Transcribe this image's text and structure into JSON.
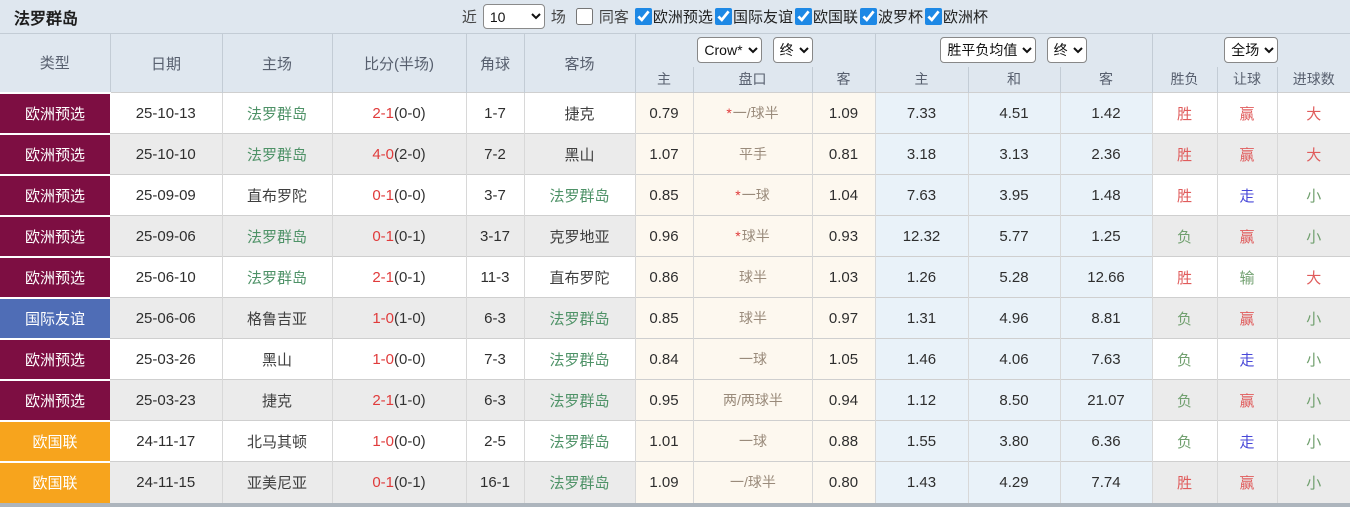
{
  "page": {
    "title": "法罗群岛"
  },
  "toolbar": {
    "recent_label": "近",
    "recent_select": "10",
    "matches_label": "场",
    "same_away_label": "同客",
    "same_away_checked": false,
    "filters": [
      {
        "label": "欧洲预选",
        "checked": true
      },
      {
        "label": "国际友谊",
        "checked": true
      },
      {
        "label": "欧国联",
        "checked": true
      },
      {
        "label": "波罗杯",
        "checked": true
      },
      {
        "label": "欧洲杯",
        "checked": true
      }
    ]
  },
  "table": {
    "static_headers": [
      "类型",
      "日期",
      "主场",
      "比分(半场)",
      "角球",
      "客场"
    ],
    "handicap_group": {
      "provider_select": "Crow*",
      "period_select": "终",
      "subheaders": [
        "主",
        "盘口",
        "客"
      ]
    },
    "europe_group": {
      "avg_select": "胜平负均值",
      "period_select": "终",
      "subheaders": [
        "主",
        "和",
        "客"
      ]
    },
    "result_group": {
      "scope_select": "全场",
      "subheaders": [
        "胜负",
        "让球",
        "进球数"
      ]
    },
    "rows": [
      {
        "type": "欧洲预选",
        "type_class": "maroon",
        "date": "25-10-13",
        "home": "法罗群岛",
        "home_subject": true,
        "score": "2-1",
        "half": "(0-0)",
        "corners": "1-7",
        "away": "捷克",
        "away_subject": false,
        "crow_home": "0.79",
        "handicap_star": true,
        "handicap": "一/球半",
        "crow_away": "1.09",
        "euro_home": "7.33",
        "euro_draw": "4.51",
        "euro_away": "1.42",
        "result": "胜",
        "result_class": "red",
        "handicap_result": "赢",
        "handicap_result_class": "red",
        "goals": "大",
        "goals_class": "red"
      },
      {
        "type": "欧洲预选",
        "type_class": "maroon",
        "date": "25-10-10",
        "home": "法罗群岛",
        "home_subject": true,
        "score": "4-0",
        "half": "(2-0)",
        "corners": "7-2",
        "away": "黑山",
        "away_subject": false,
        "crow_home": "1.07",
        "handicap_star": false,
        "handicap": "平手",
        "crow_away": "0.81",
        "euro_home": "3.18",
        "euro_draw": "3.13",
        "euro_away": "2.36",
        "result": "胜",
        "result_class": "red",
        "handicap_result": "赢",
        "handicap_result_class": "red",
        "goals": "大",
        "goals_class": "red"
      },
      {
        "type": "欧洲预选",
        "type_class": "maroon",
        "date": "25-09-09",
        "home": "直布罗陀",
        "home_subject": false,
        "score": "0-1",
        "half": "(0-0)",
        "corners": "3-7",
        "away": "法罗群岛",
        "away_subject": true,
        "crow_home": "0.85",
        "handicap_star": true,
        "handicap": "一球",
        "crow_away": "1.04",
        "euro_home": "7.63",
        "euro_draw": "3.95",
        "euro_away": "1.48",
        "result": "胜",
        "result_class": "red",
        "handicap_result": "走",
        "handicap_result_class": "blue",
        "goals": "小",
        "goals_class": "green"
      },
      {
        "type": "欧洲预选",
        "type_class": "maroon",
        "date": "25-09-06",
        "home": "法罗群岛",
        "home_subject": true,
        "score": "0-1",
        "half": "(0-1)",
        "corners": "3-17",
        "away": "克罗地亚",
        "away_subject": false,
        "crow_home": "0.96",
        "handicap_star": true,
        "handicap": "球半",
        "crow_away": "0.93",
        "euro_home": "12.32",
        "euro_draw": "5.77",
        "euro_away": "1.25",
        "result": "负",
        "result_class": "green",
        "handicap_result": "赢",
        "handicap_result_class": "red",
        "goals": "小",
        "goals_class": "green"
      },
      {
        "type": "欧洲预选",
        "type_class": "maroon",
        "date": "25-06-10",
        "home": "法罗群岛",
        "home_subject": true,
        "score": "2-1",
        "half": "(0-1)",
        "corners": "11-3",
        "away": "直布罗陀",
        "away_subject": false,
        "crow_home": "0.86",
        "handicap_star": false,
        "handicap": "球半",
        "crow_away": "1.03",
        "euro_home": "1.26",
        "euro_draw": "5.28",
        "euro_away": "12.66",
        "result": "胜",
        "result_class": "red",
        "handicap_result": "输",
        "handicap_result_class": "green",
        "goals": "大",
        "goals_class": "red"
      },
      {
        "type": "国际友谊",
        "type_class": "blue",
        "date": "25-06-06",
        "home": "格鲁吉亚",
        "home_subject": false,
        "score": "1-0",
        "half": "(1-0)",
        "corners": "6-3",
        "away": "法罗群岛",
        "away_subject": true,
        "crow_home": "0.85",
        "handicap_star": false,
        "handicap": "球半",
        "crow_away": "0.97",
        "euro_home": "1.31",
        "euro_draw": "4.96",
        "euro_away": "8.81",
        "result": "负",
        "result_class": "green",
        "handicap_result": "赢",
        "handicap_result_class": "red",
        "goals": "小",
        "goals_class": "green"
      },
      {
        "type": "欧洲预选",
        "type_class": "maroon",
        "date": "25-03-26",
        "home": "黑山",
        "home_subject": false,
        "score": "1-0",
        "half": "(0-0)",
        "corners": "7-3",
        "away": "法罗群岛",
        "away_subject": true,
        "crow_home": "0.84",
        "handicap_star": false,
        "handicap": "一球",
        "crow_away": "1.05",
        "euro_home": "1.46",
        "euro_draw": "4.06",
        "euro_away": "7.63",
        "result": "负",
        "result_class": "green",
        "handicap_result": "走",
        "handicap_result_class": "blue",
        "goals": "小",
        "goals_class": "green"
      },
      {
        "type": "欧洲预选",
        "type_class": "maroon",
        "date": "25-03-23",
        "home": "捷克",
        "home_subject": false,
        "score": "2-1",
        "half": "(1-0)",
        "corners": "6-3",
        "away": "法罗群岛",
        "away_subject": true,
        "crow_home": "0.95",
        "handicap_star": false,
        "handicap": "两/两球半",
        "crow_away": "0.94",
        "euro_home": "1.12",
        "euro_draw": "8.50",
        "euro_away": "21.07",
        "result": "负",
        "result_class": "green",
        "handicap_result": "赢",
        "handicap_result_class": "red",
        "goals": "小",
        "goals_class": "green"
      },
      {
        "type": "欧国联",
        "type_class": "orange",
        "date": "24-11-17",
        "home": "北马其顿",
        "home_subject": false,
        "score": "1-0",
        "half": "(0-0)",
        "corners": "2-5",
        "away": "法罗群岛",
        "away_subject": true,
        "crow_home": "1.01",
        "handicap_star": false,
        "handicap": "一球",
        "crow_away": "0.88",
        "euro_home": "1.55",
        "euro_draw": "3.80",
        "euro_away": "6.36",
        "result": "负",
        "result_class": "green",
        "handicap_result": "走",
        "handicap_result_class": "blue",
        "goals": "小",
        "goals_class": "green"
      },
      {
        "type": "欧国联",
        "type_class": "orange",
        "date": "24-11-15",
        "home": "亚美尼亚",
        "home_subject": false,
        "score": "0-1",
        "half": "(0-1)",
        "corners": "16-1",
        "away": "法罗群岛",
        "away_subject": true,
        "crow_home": "1.09",
        "handicap_star": false,
        "handicap": "一/球半",
        "crow_away": "0.80",
        "euro_home": "1.43",
        "euro_draw": "4.29",
        "euro_away": "7.74",
        "result": "胜",
        "result_class": "red",
        "handicap_result": "赢",
        "handicap_result_class": "red",
        "goals": "小",
        "goals_class": "green"
      }
    ]
  },
  "colors": {
    "type_maroon": "#7d0e42",
    "type_blue": "#4f6db6",
    "type_orange": "#f7a41d",
    "subject_team_green": "#4e9267",
    "score_red": "#e03b3b",
    "win_red": "#e05c5c",
    "lose_green": "#71a06f",
    "push_blue": "#4848d8",
    "crow_col_bg": "#fdf8ef",
    "euro_col_bg": "#e9f2f9",
    "header_bg": "#dfe7ef"
  }
}
